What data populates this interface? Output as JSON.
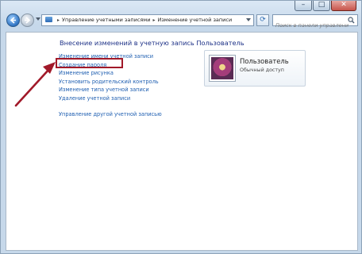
{
  "window": {
    "caption_buttons": {
      "minimize": "–",
      "maximize": "□",
      "close": "✕"
    }
  },
  "toolbar": {
    "breadcrumb": [
      "Управление учетными записями",
      "Изменение учетной записи"
    ],
    "breadcrumb_separator": "▸",
    "search_placeholder": "Поиск в панели управления"
  },
  "main": {
    "heading": "Внесение изменений в учетную запись Пользователь",
    "links": [
      "Изменение имени учетной записи",
      "Создание пароля",
      "Изменение рисунка",
      "Установить родительский контроль",
      "Изменение типа учетной записи",
      "Удаление учетной записи",
      "Управление другой учетной записью"
    ],
    "highlighted_link_index": 1,
    "highlight_color": "#a11929"
  },
  "user": {
    "name": "Пользователь",
    "role": "Обычный доступ"
  },
  "icons": [
    "back-arrow-icon",
    "forward-arrow-icon",
    "folder-icon",
    "refresh-icon",
    "search-icon",
    "user-avatar-icon"
  ]
}
